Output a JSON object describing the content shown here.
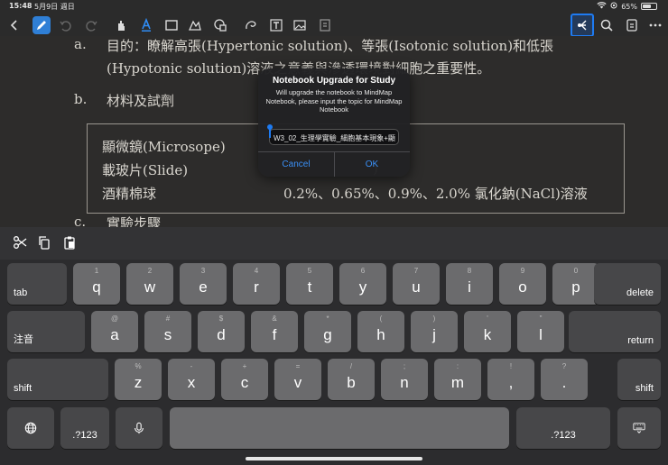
{
  "status_bar": {
    "time": "15:48",
    "date": "5月9日 週日",
    "battery_text": "65%",
    "battery_level": 0.65
  },
  "toolbar": {
    "icons": [
      "back-icon",
      "pen-icon",
      "undo-icon",
      "redo-icon",
      "hand-icon",
      "text-color-icon",
      "rectangle-icon",
      "shapes-icon",
      "sticker-icon",
      "lasso-icon",
      "textbox-icon",
      "image-icon",
      "extract-icon",
      "mindmap-icon",
      "search-icon",
      "export-icon",
      "more-icon"
    ],
    "active_color": "#2f7fd6",
    "highlight_color": "#1e7bf2"
  },
  "document": {
    "item_a_label": "a.",
    "item_a_text": "目的：瞭解高張(Hypertonic solution)、等張(Isotonic solution)和低張",
    "item_a_text2": "(Hypotonic solution)溶液之意義與滲透環境對細胞之重要性。",
    "item_b_label": "b.",
    "item_b_text": "材料及試劑",
    "table": {
      "left": [
        "顯微鏡(Microsope)",
        "載玻片(Slide)",
        "酒精棉球"
      ],
      "right": [
        "",
        ")",
        "0.2%、0.65%、0.9%、2.0%  氯化鈉(NaCl)溶液"
      ]
    },
    "item_c_label": "c.",
    "item_c_text": "實驗步驟"
  },
  "dialog": {
    "title": "Notebook Upgrade for Study",
    "message": "Will upgrade the notebook to MindMap Notebook, please input the topic for MindMap Notebook",
    "input_value": "W3_02_生理學實驗_細胞基本現象+顯",
    "cancel_label": "Cancel",
    "ok_label": "OK",
    "button_color": "#3a8ff5"
  },
  "keyboard": {
    "shortcut_icons": [
      "scissors-icon",
      "copy-icon",
      "paste-icon"
    ],
    "row1": {
      "tab_label": "tab",
      "keys": [
        {
          "main": "q",
          "hint": "1"
        },
        {
          "main": "w",
          "hint": "2"
        },
        {
          "main": "e",
          "hint": "3"
        },
        {
          "main": "r",
          "hint": "4"
        },
        {
          "main": "t",
          "hint": "5"
        },
        {
          "main": "y",
          "hint": "6"
        },
        {
          "main": "u",
          "hint": "7"
        },
        {
          "main": "i",
          "hint": "8"
        },
        {
          "main": "o",
          "hint": "9"
        },
        {
          "main": "p",
          "hint": "0"
        }
      ],
      "delete_label": "delete"
    },
    "row2": {
      "zhuyin_label": "注音",
      "keys": [
        {
          "main": "a",
          "hint": "@"
        },
        {
          "main": "s",
          "hint": "#"
        },
        {
          "main": "d",
          "hint": "$"
        },
        {
          "main": "f",
          "hint": "&"
        },
        {
          "main": "g",
          "hint": "*"
        },
        {
          "main": "h",
          "hint": "("
        },
        {
          "main": "j",
          "hint": ")"
        },
        {
          "main": "k",
          "hint": "'"
        },
        {
          "main": "l",
          "hint": "\""
        }
      ],
      "return_label": "return"
    },
    "row3": {
      "shift_label": "shift",
      "keys": [
        {
          "main": "z",
          "hint": "%"
        },
        {
          "main": "x",
          "hint": "-"
        },
        {
          "main": "c",
          "hint": "+"
        },
        {
          "main": "v",
          "hint": "="
        },
        {
          "main": "b",
          "hint": "/"
        },
        {
          "main": "n",
          "hint": ";"
        },
        {
          "main": "m",
          "hint": ":"
        },
        {
          "main": ",",
          "hint": "!"
        },
        {
          "main": ".",
          "hint": "?"
        }
      ],
      "shift_right_label": "shift"
    },
    "row4": {
      "globe_icon": "globe-icon",
      "numbers_label": ".?123",
      "mic_icon": "microphone-icon",
      "numbers_right_label": ".?123",
      "hide_icon": "keyboard-hide-icon"
    }
  }
}
